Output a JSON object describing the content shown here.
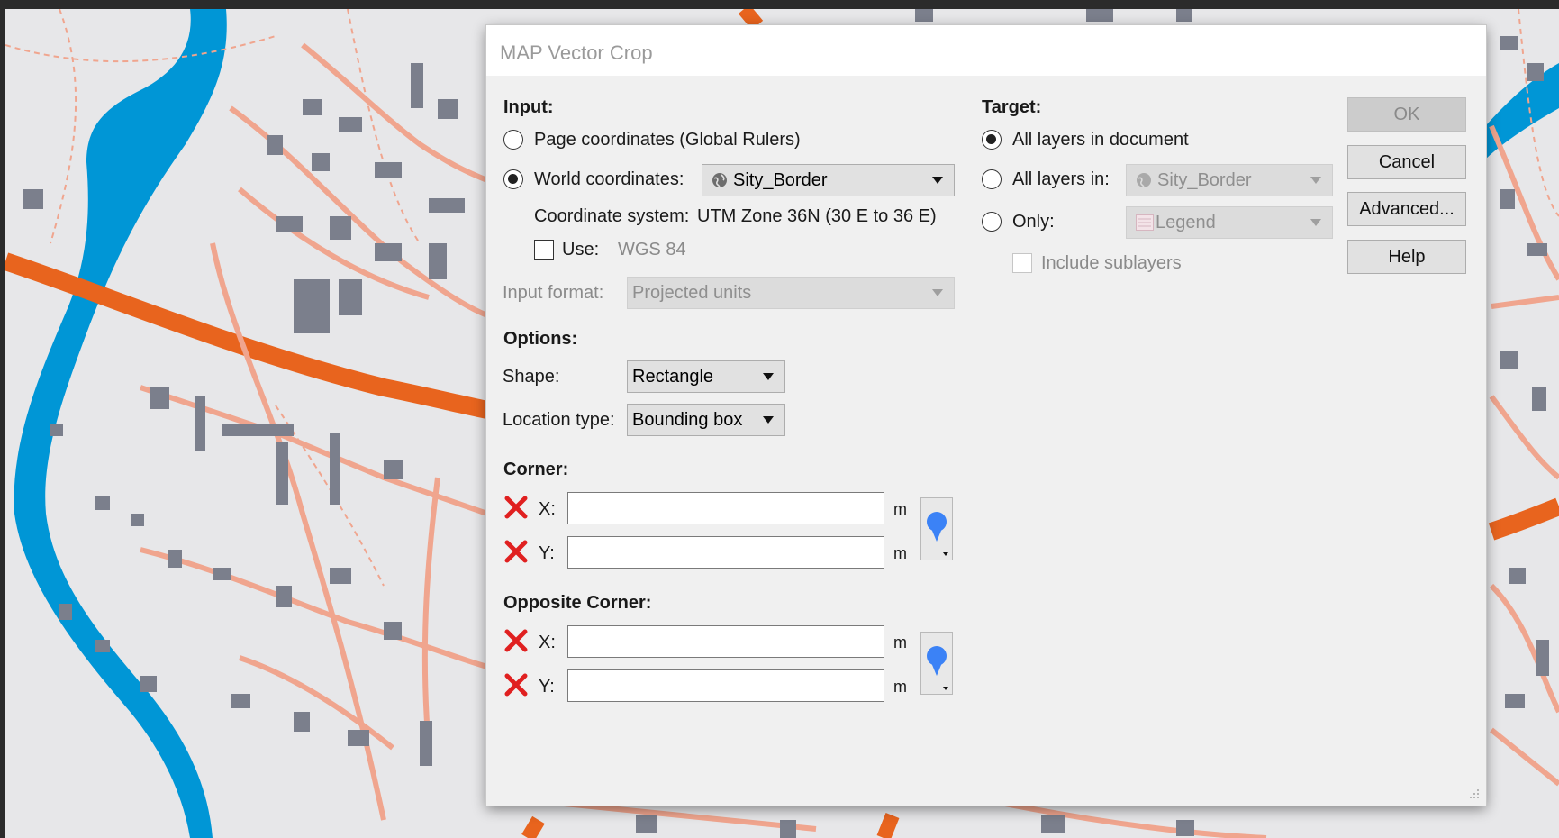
{
  "dialog": {
    "title": "MAP Vector Crop"
  },
  "input": {
    "header": "Input:",
    "page_coordinates_label": "Page coordinates (Global Rulers)",
    "world_coordinates_label": "World coordinates:",
    "world_layer_value": "Sity_Border",
    "coordinate_system_label": "Coordinate system:",
    "coordinate_system_value": "UTM Zone 36N (30 E to 36 E)",
    "use_label": "Use:",
    "use_value": "WGS 84",
    "input_format_label": "Input format:",
    "input_format_value": "Projected units"
  },
  "options": {
    "header": "Options:",
    "shape_label": "Shape:",
    "shape_value": "Rectangle",
    "location_type_label": "Location type:",
    "location_type_value": "Bounding box"
  },
  "corner": {
    "header": "Corner:",
    "x_label": "X:",
    "y_label": "Y:",
    "x_value": "",
    "y_value": "",
    "unit": "m"
  },
  "opposite_corner": {
    "header": "Opposite Corner:",
    "x_label": "X:",
    "y_label": "Y:",
    "x_value": "",
    "y_value": "",
    "unit": "m"
  },
  "target": {
    "header": "Target:",
    "all_layers_doc_label": "All layers in document",
    "all_layers_in_label": "All layers in:",
    "all_layers_in_value": "Sity_Border",
    "only_label": "Only:",
    "only_value": "Legend",
    "include_sublayers_label": "Include sublayers"
  },
  "buttons": {
    "ok": "OK",
    "cancel": "Cancel",
    "advanced": "Advanced...",
    "help": "Help"
  },
  "colors": {
    "map_background": "#e7e7e9",
    "water": "#0096d6",
    "major_road": "#e8641e",
    "minor_road": "#f0a58e",
    "buildings": "#7b7f8c",
    "error_x": "#e02020",
    "pin": "#3b82f6"
  },
  "icons": {
    "globe": "globe-icon",
    "legend": "legend-icon",
    "error": "error-x-icon",
    "pin": "map-pin-icon"
  }
}
